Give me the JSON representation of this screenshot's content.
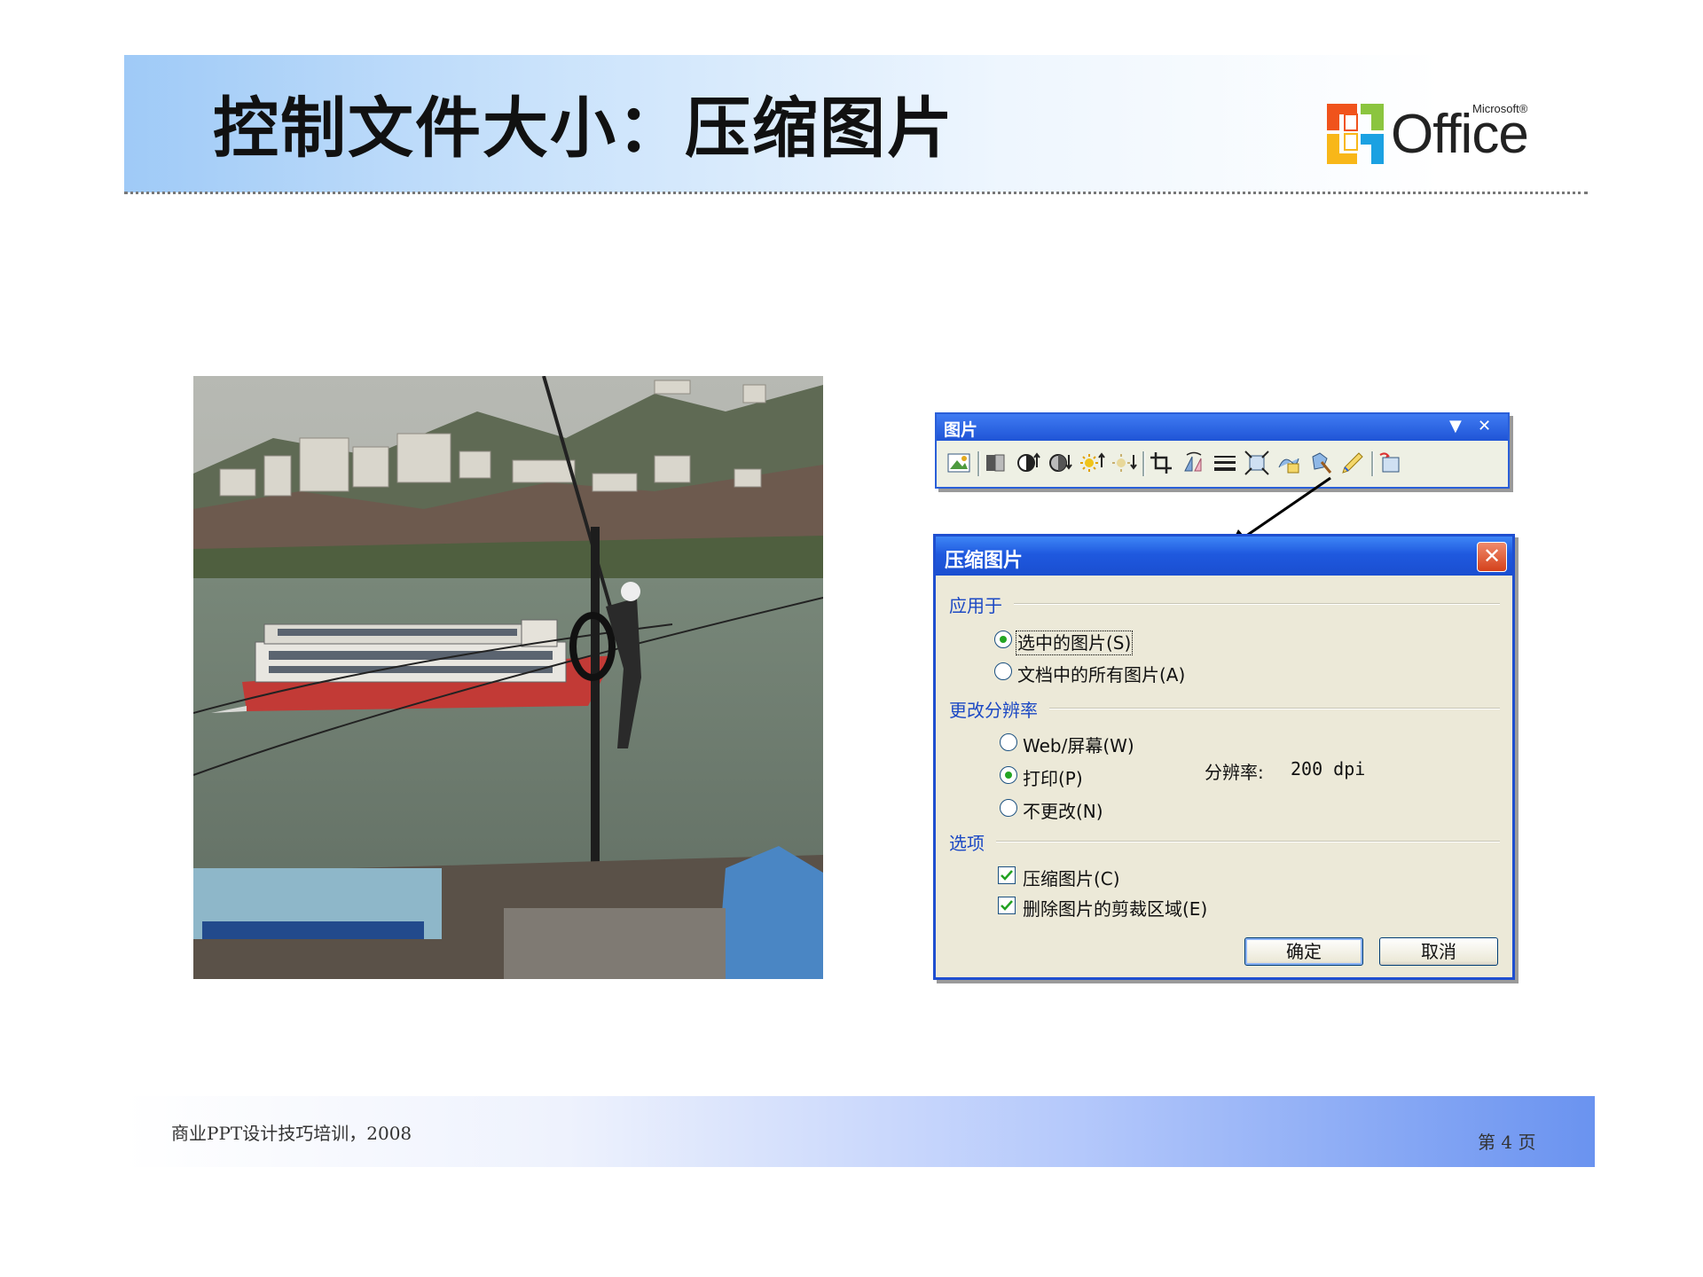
{
  "slide": {
    "title": "控制文件大小：压缩图片"
  },
  "logo": {
    "word": "Office",
    "superscript": "Microsoft®"
  },
  "toolbar": {
    "title": "图片",
    "dropdown_glyph": "▼",
    "close_glyph": "✕",
    "buttons": [
      "insert-picture-icon",
      "color-icon",
      "more-contrast-icon",
      "less-contrast-icon",
      "more-brightness-icon",
      "less-brightness-icon",
      "crop-icon",
      "rotate-left-icon",
      "line-style-icon",
      "compress-pictures-icon",
      "text-wrapping-icon",
      "format-picture-icon",
      "set-transparent-color-icon",
      "reset-picture-icon"
    ]
  },
  "dialog": {
    "title": "压缩图片",
    "close_glyph": "✕",
    "apply_to": {
      "label": "应用于",
      "options": [
        "选中的图片(S)",
        "文档中的所有图片(A)"
      ],
      "selected": 0
    },
    "resolution": {
      "label": "更改分辨率",
      "options": [
        "Web/屏幕(W)",
        "打印(P)",
        "不更改(N)"
      ],
      "selected": 1,
      "value_label": "分辨率:",
      "value": "200 dpi"
    },
    "options": {
      "label": "选项",
      "checkboxes": [
        {
          "label": "压缩图片(C)",
          "checked": true
        },
        {
          "label": "删除图片的剪裁区域(E)",
          "checked": true
        }
      ]
    },
    "ok_label": "确定",
    "cancel_label": "取消"
  },
  "footer": {
    "left": "商业PPT设计技巧培训，2008",
    "right": "第 4 页"
  },
  "colors": {
    "title_bar": "#1f59df",
    "dialog_bg": "#ece9d8",
    "group_label": "#1c49c4",
    "radio_dot": "#23a523"
  }
}
